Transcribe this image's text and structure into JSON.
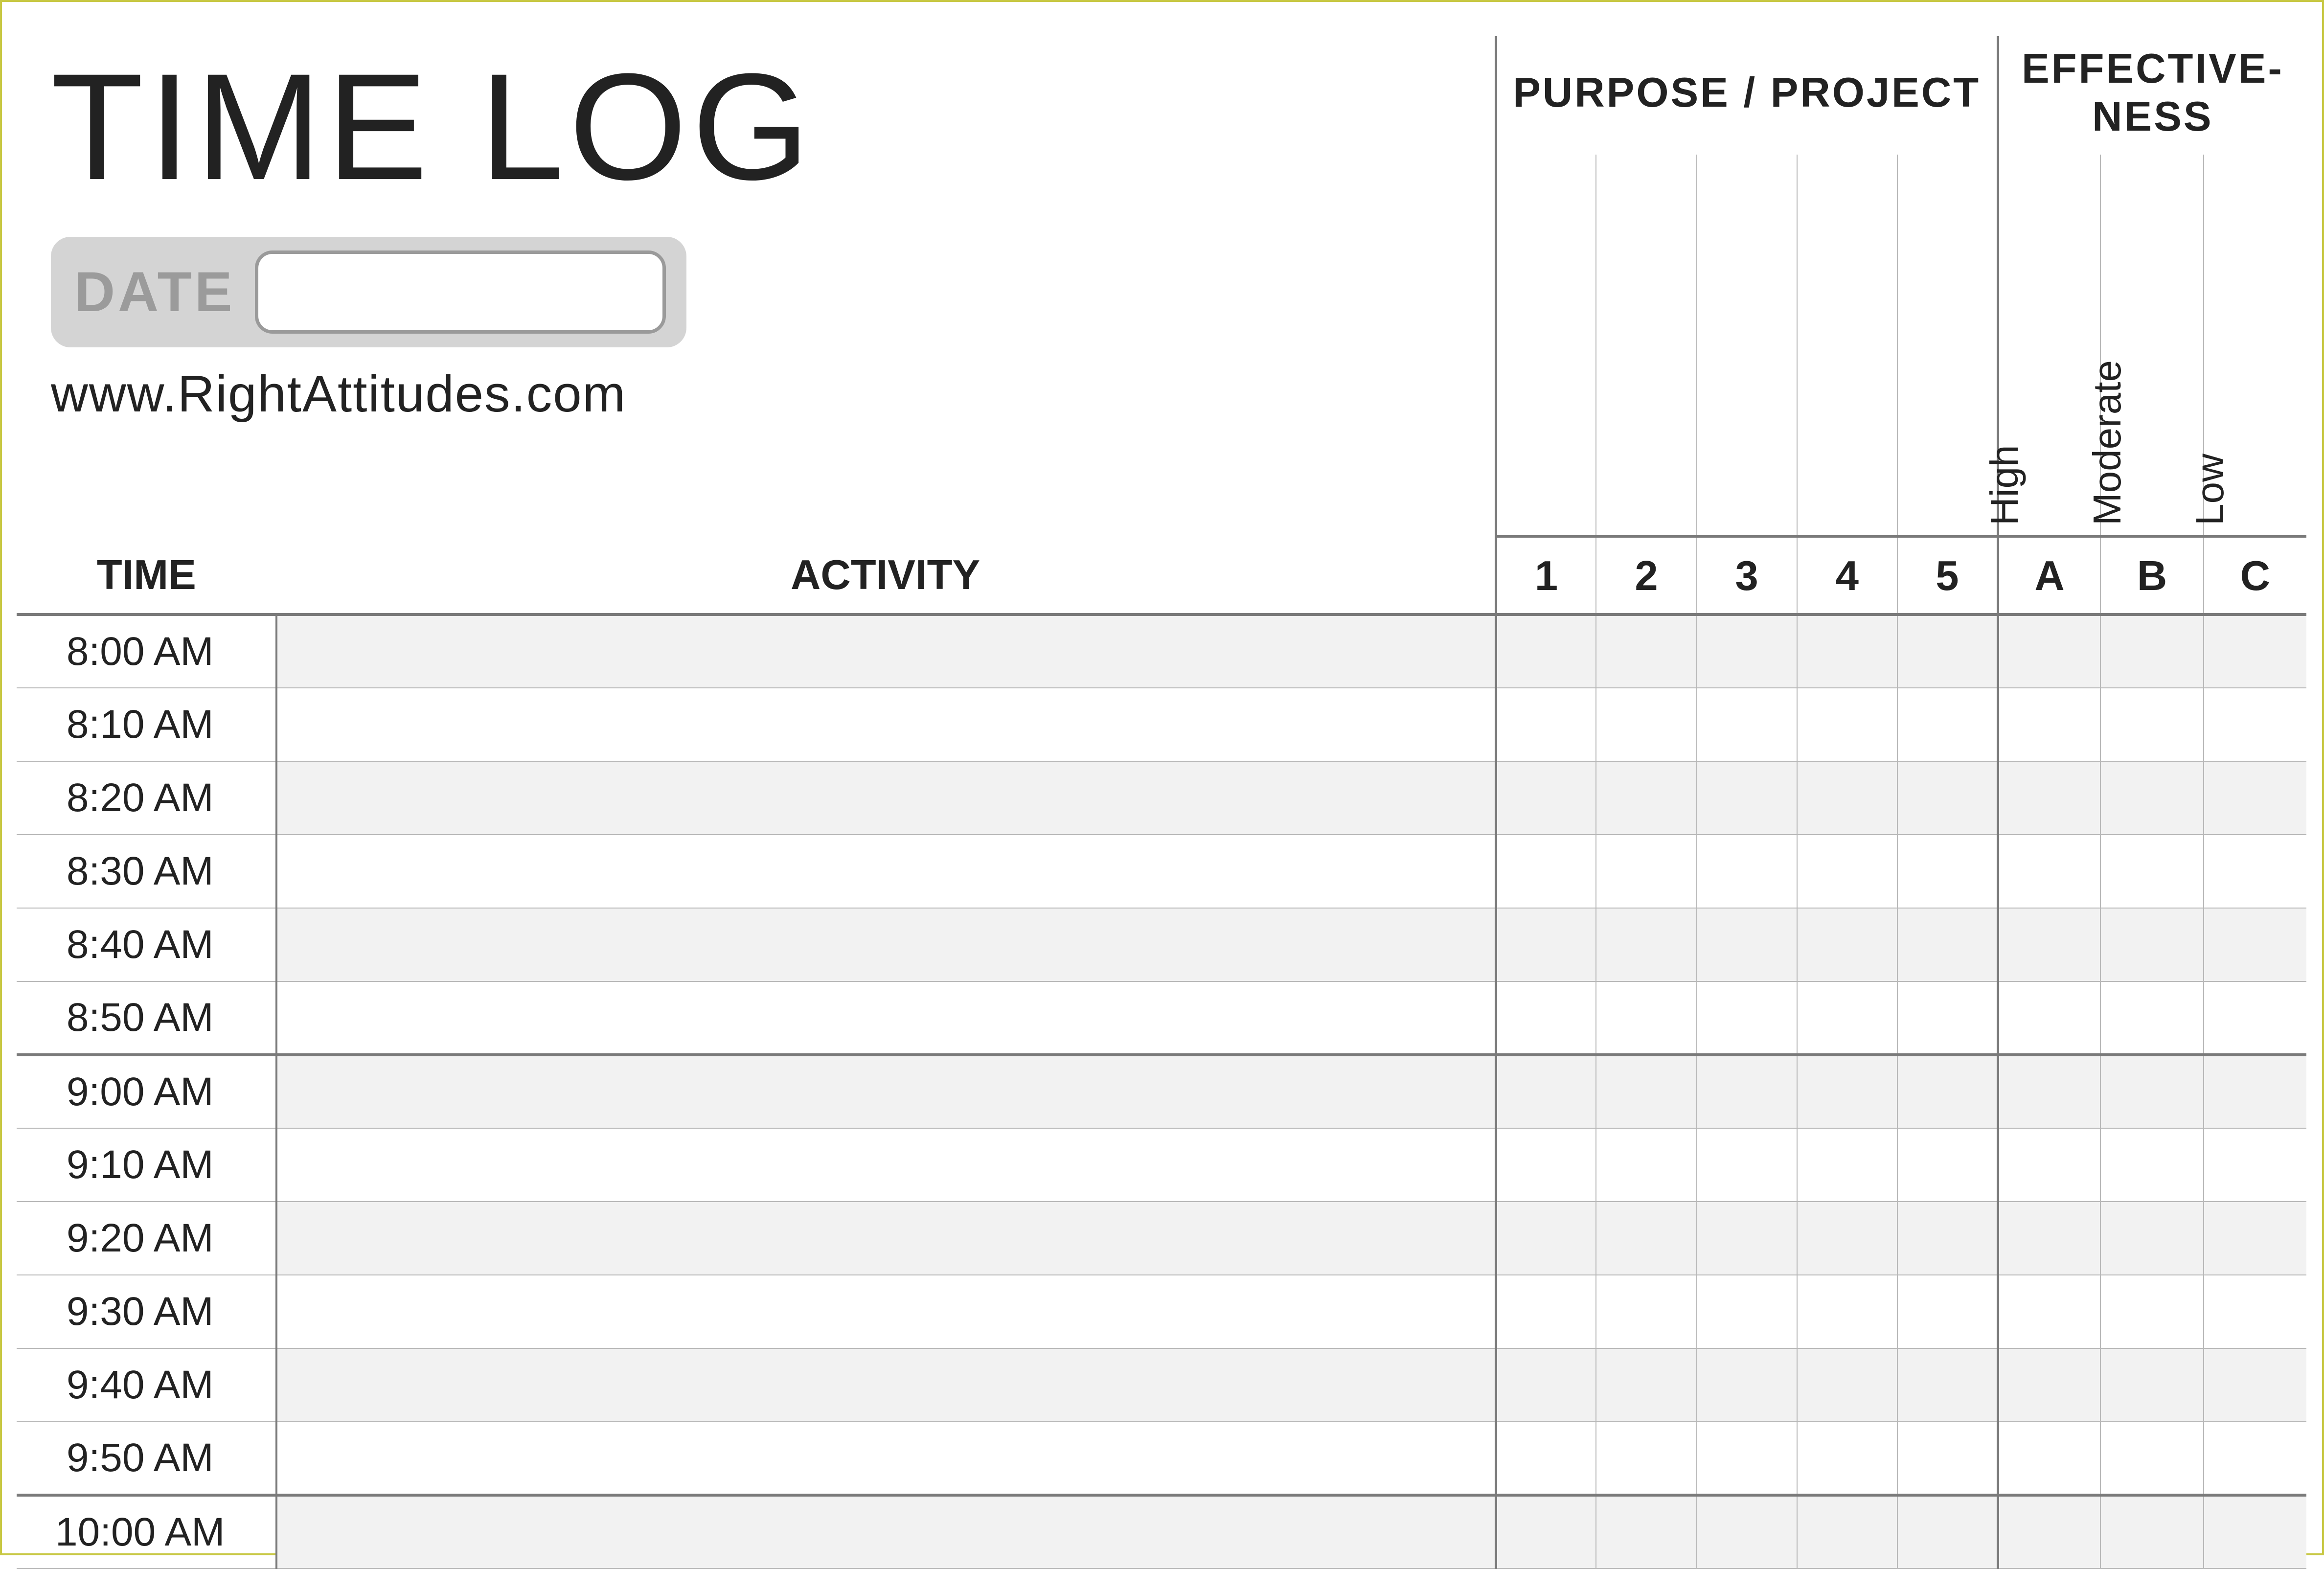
{
  "header": {
    "title": "TIME LOG",
    "date_label": "DATE",
    "date_value": "",
    "url": "www.RightAttitudes.com"
  },
  "columns": {
    "time_header": "TIME",
    "activity_header": "ACTIVITY",
    "purpose_group": "PURPOSE / PROJECT",
    "effectiveness_group": "EFFECTIVE-\nNESS",
    "purpose_numbers": [
      "1",
      "2",
      "3",
      "4",
      "5"
    ],
    "effectiveness": [
      {
        "code": "A",
        "label": "High"
      },
      {
        "code": "B",
        "label": "Moderate"
      },
      {
        "code": "C",
        "label": "Low"
      }
    ]
  },
  "rows": [
    {
      "time": "8:00 AM",
      "hour_top": true
    },
    {
      "time": "8:10 AM"
    },
    {
      "time": "8:20 AM"
    },
    {
      "time": "8:30 AM"
    },
    {
      "time": "8:40 AM"
    },
    {
      "time": "8:50 AM"
    },
    {
      "time": "9:00 AM",
      "hour_top": true
    },
    {
      "time": "9:10 AM"
    },
    {
      "time": "9:20 AM"
    },
    {
      "time": "9:30 AM"
    },
    {
      "time": "9:40 AM"
    },
    {
      "time": "9:50 AM"
    },
    {
      "time": "10:00 AM",
      "hour_top": true
    }
  ]
}
